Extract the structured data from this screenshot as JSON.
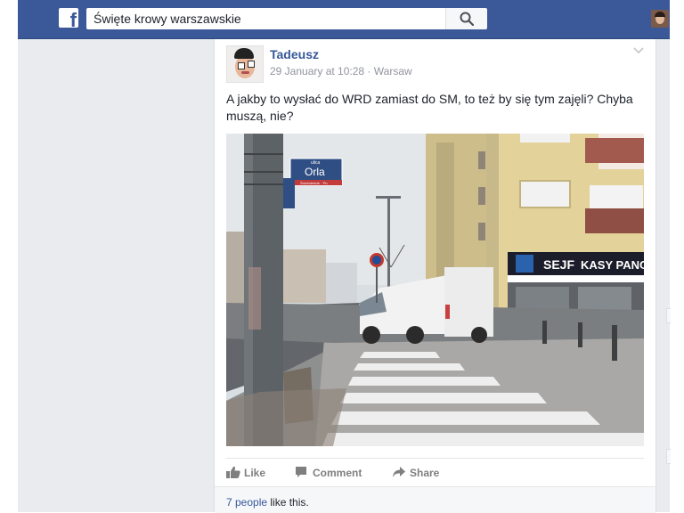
{
  "header": {
    "search_value": "Święte krowy warszawskie",
    "logo_letter": "f"
  },
  "post": {
    "author": "Tadeusz",
    "date": "29 January at 10:28",
    "location": "Warsaw",
    "separator": "·",
    "text": "A jakby to wysłać do WRD zamiast do SM, to też by się tym zajęli? Chyba muszą, nie?",
    "photo": {
      "street_sign_small": "ulica",
      "street_sign_name": "Orla",
      "street_sign_sub": "Śródmieście · Pn.",
      "shop_sign_1": "SEJF",
      "shop_sign_2": "KASY PANC"
    },
    "actions": {
      "like": "Like",
      "comment": "Comment",
      "share": "Share"
    },
    "likes": {
      "count_text": "7 people",
      "suffix": " like this."
    }
  },
  "colors": {
    "brand_blue": "#3b5998",
    "link_blue": "#365899"
  }
}
